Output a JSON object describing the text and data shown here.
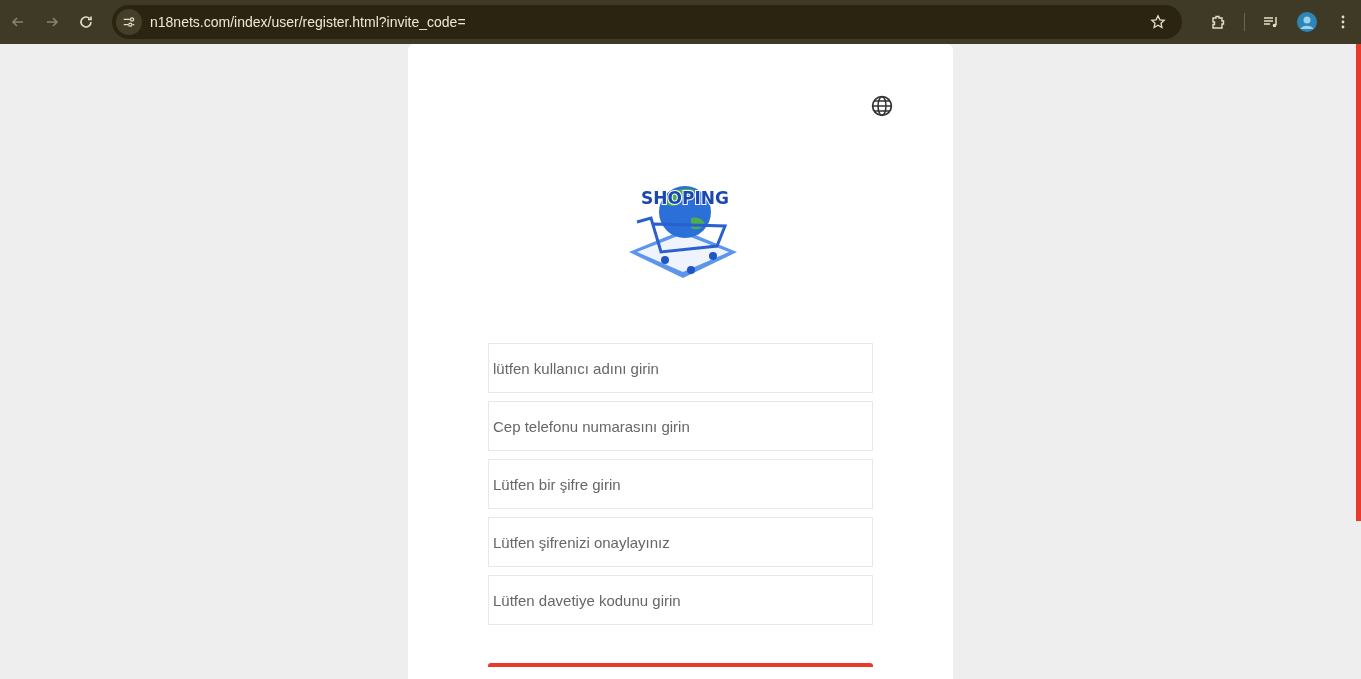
{
  "browser": {
    "url": "n18nets.com/index/user/register.html?invite_code="
  },
  "logo": {
    "text": "SHOPING"
  },
  "fields": [
    {
      "placeholder": "lütfen kullanıcı adını girin"
    },
    {
      "placeholder": "Cep telefonu numarasını girin"
    },
    {
      "placeholder": "Lütfen bir şifre girin"
    },
    {
      "placeholder": "Lütfen şifrenizi onaylayınız"
    },
    {
      "placeholder": "Lütfen davetiye kodunu girin"
    }
  ]
}
